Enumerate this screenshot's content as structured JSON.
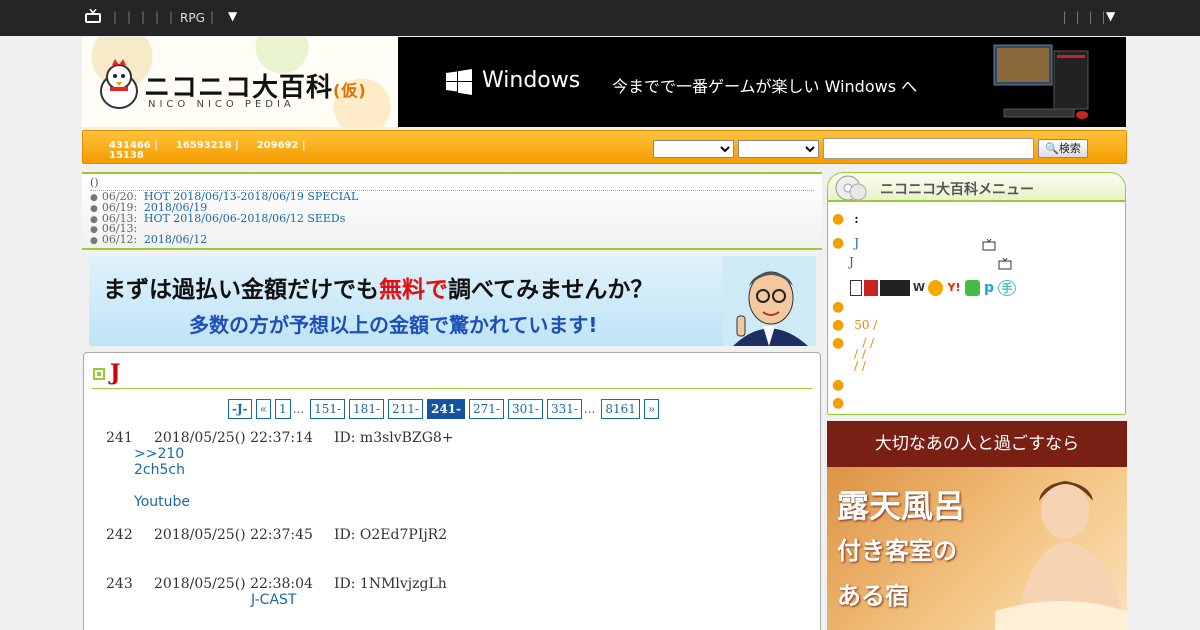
{
  "topbar": {
    "rpg_label": "RPG",
    "dropdown_glyph": "▼",
    "separator_glyph": "|"
  },
  "header": {
    "logo_text": "ニコニコ大百科",
    "logo_kari": "(仮)",
    "logo_sub": "NICO NICO PEDIA",
    "ad": {
      "brand": "Windows",
      "message": "今までで一番ゲームが楽しい Windows へ"
    }
  },
  "stats": {
    "s1": "431466 |",
    "s2": "16593218 |",
    "s3": "209692 |",
    "s4": "15138"
  },
  "search": {
    "button_label": "検索",
    "input_value": ""
  },
  "news": {
    "title": "()",
    "items": [
      {
        "date": "06/20:",
        "text": "HOT 2018/06/13-2018/06/19  SPECIAL"
      },
      {
        "date": "06/19:",
        "text": "2018/06/19"
      },
      {
        "date": "06/13:",
        "text": "HOT 2018/06/06-2018/06/12 SEEDs"
      },
      {
        "date": "06/13:",
        "text": ""
      },
      {
        "date": "06/12:",
        "text": "2018/06/12"
      }
    ]
  },
  "banner_ad": {
    "line1_a": "まずは過払い金額だけでも",
    "line1_red": "無料で",
    "line1_b": "調べてみませんか？",
    "line2": "多数の方が予想以上の金額で驚かれています!"
  },
  "article": {
    "title": "J",
    "pager": [
      "-J-",
      "«",
      "1",
      "...",
      "151-",
      "181-",
      "211-",
      "241-",
      "271-",
      "301-",
      "331-",
      "...",
      "8161",
      "»"
    ],
    "current_page": "241-",
    "posts": [
      {
        "num": "241",
        "date": "2018/05/25() 22:37:14",
        "id": "ID: m3slvBZG8+",
        "lines": [
          ">>210",
          "2ch5ch",
          "",
          "Youtube"
        ]
      },
      {
        "num": "242",
        "date": "2018/05/25() 22:37:45",
        "id": "ID: O2Ed7PIjR2",
        "lines": []
      },
      {
        "num": "243",
        "date": "2018/05/25() 22:38:04",
        "id": "ID: 1NMlvjzgLh",
        "lines": [
          "J-CAST"
        ]
      }
    ]
  },
  "menu": {
    "title": "ニコニコ大百科メニュー",
    "item1": ":",
    "item2a": "J",
    "item2b": "J",
    "item5": "50   /",
    "item6a": "/ /",
    "item6b": "/ /",
    "item6c": "/ /",
    "services": [
      "W",
      "Y!",
      "p",
      "手"
    ]
  },
  "hotel_ad": {
    "top": "大切なあの人と過ごすなら",
    "line1": "露天風呂",
    "line2": "付き客室の",
    "line3": "ある宿"
  },
  "colors": {
    "accent_green": "#99cc33",
    "link_blue": "#1a6aa8",
    "title_red": "#d40000",
    "bar_orange": "#f59b00"
  }
}
